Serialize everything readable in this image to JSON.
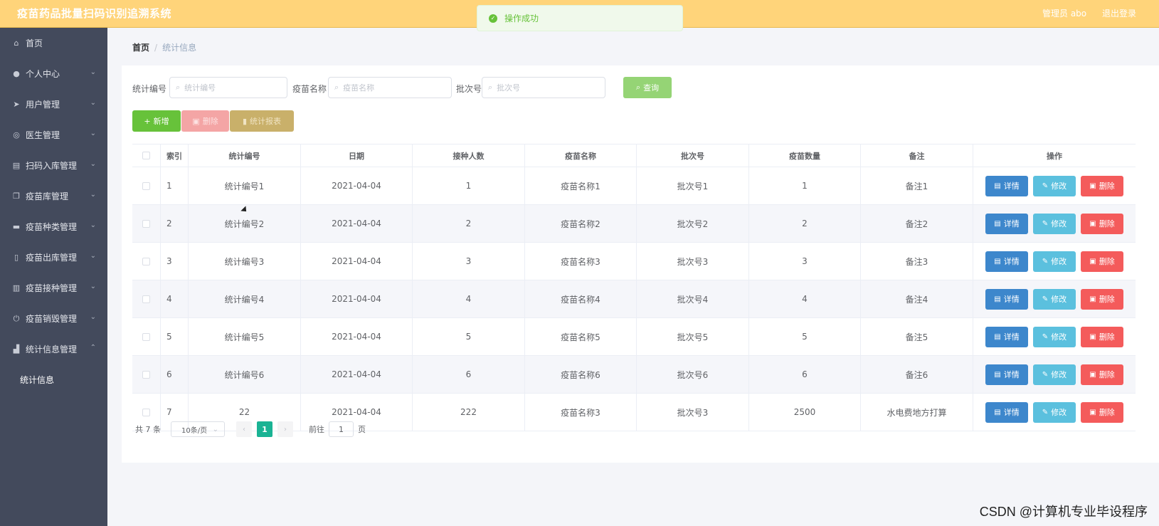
{
  "app": {
    "title": "疫苗药品批量扫码识别追溯系统",
    "user": "管理员 abo",
    "logout": "退出登录"
  },
  "toast": {
    "message": "操作成功"
  },
  "sidebar": {
    "items": [
      {
        "label": "首页",
        "icon": "home-icon"
      },
      {
        "label": "个人中心",
        "icon": "user-icon"
      },
      {
        "label": "用户管理",
        "icon": "send-icon"
      },
      {
        "label": "医生管理",
        "icon": "globe-icon"
      },
      {
        "label": "扫码入库管理",
        "icon": "box-icon"
      },
      {
        "label": "疫苗库管理",
        "icon": "copy-icon"
      },
      {
        "label": "疫苗种类管理",
        "icon": "ticket-icon"
      },
      {
        "label": "疫苗出库管理",
        "icon": "mic-icon"
      },
      {
        "label": "疫苗接种管理",
        "icon": "clipboard-icon"
      },
      {
        "label": "疫苗销毁管理",
        "icon": "power-icon"
      },
      {
        "label": "统计信息管理",
        "icon": "chart-icon"
      }
    ],
    "sub_item": "统计信息"
  },
  "breadcrumb": {
    "home": "首页",
    "sep": "/",
    "current": "统计信息"
  },
  "search": {
    "label1": "统计编号",
    "placeholder1": "统计编号",
    "label2": "疫苗名称",
    "placeholder2": "疫苗名称",
    "label3": "批次号",
    "placeholder3": "批次号",
    "button": "查询"
  },
  "toolbar": {
    "add": "新增",
    "delete": "删除",
    "report": "统计报表"
  },
  "table": {
    "headers": [
      "索引",
      "统计编号",
      "日期",
      "接种人数",
      "疫苗名称",
      "批次号",
      "疫苗数量",
      "备注",
      "操作"
    ],
    "actions": {
      "detail": "详情",
      "edit": "修改",
      "remove": "删除"
    },
    "rows": [
      {
        "index": "1",
        "code": "统计编号1",
        "date": "2021-04-04",
        "count": "1",
        "vaccine": "疫苗名称1",
        "batch": "批次号1",
        "qty": "1",
        "note": "备注1"
      },
      {
        "index": "2",
        "code": "统计编号2",
        "date": "2021-04-04",
        "count": "2",
        "vaccine": "疫苗名称2",
        "batch": "批次号2",
        "qty": "2",
        "note": "备注2"
      },
      {
        "index": "3",
        "code": "统计编号3",
        "date": "2021-04-04",
        "count": "3",
        "vaccine": "疫苗名称3",
        "batch": "批次号3",
        "qty": "3",
        "note": "备注3"
      },
      {
        "index": "4",
        "code": "统计编号4",
        "date": "2021-04-04",
        "count": "4",
        "vaccine": "疫苗名称4",
        "batch": "批次号4",
        "qty": "4",
        "note": "备注4"
      },
      {
        "index": "5",
        "code": "统计编号5",
        "date": "2021-04-04",
        "count": "5",
        "vaccine": "疫苗名称5",
        "batch": "批次号5",
        "qty": "5",
        "note": "备注5"
      },
      {
        "index": "6",
        "code": "统计编号6",
        "date": "2021-04-04",
        "count": "6",
        "vaccine": "疫苗名称6",
        "batch": "批次号6",
        "qty": "6",
        "note": "备注6"
      },
      {
        "index": "7",
        "code": "22",
        "date": "2021-04-04",
        "count": "222",
        "vaccine": "疫苗名称3",
        "batch": "批次号3",
        "qty": "2500",
        "note": "水电费地方打算"
      }
    ]
  },
  "pagination": {
    "total": "共 7 条",
    "page_size": "10条/页",
    "current_page": "1",
    "goto_prefix": "前往",
    "goto_value": "1",
    "goto_suffix": "页"
  },
  "watermark": "CSDN @计算机专业毕设程序",
  "colors": {
    "topbar": "#ffd47a",
    "sidebar": "#434a5c",
    "primary": "#1ab394",
    "success": "#67c23a",
    "danger": "#f45b5b",
    "info": "#5bc0de"
  }
}
